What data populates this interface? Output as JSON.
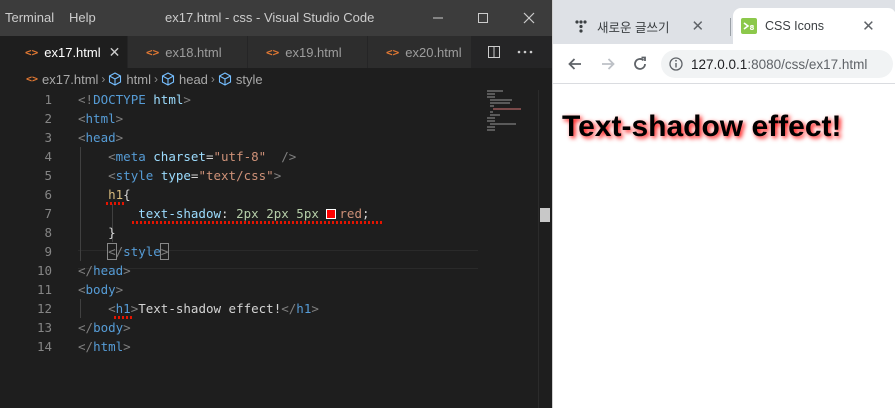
{
  "vscode": {
    "menu": [
      "Terminal",
      "Help"
    ],
    "window_title": "ex17.html - css - Visual Studio Code",
    "tabs": [
      {
        "label": "ex17.html",
        "active": true
      },
      {
        "label": "ex18.html",
        "active": false
      },
      {
        "label": "ex19.html",
        "active": false
      },
      {
        "label": "ex20.html",
        "active": false
      }
    ],
    "breadcrumb": [
      "ex17.html",
      "html",
      "head",
      "style"
    ],
    "line_numbers": [
      "1",
      "2",
      "3",
      "4",
      "5",
      "6",
      "7",
      "8",
      "9",
      "10",
      "11",
      "12",
      "13",
      "14"
    ],
    "code": {
      "l1": {
        "open": "<!",
        "tag": "DOCTYPE",
        "rest": " html",
        "close": ">"
      },
      "l2": {
        "tag": "html"
      },
      "l3": {
        "tag": "head"
      },
      "l4": {
        "tag": "meta",
        "attr": "charset",
        "eq": "=",
        "val": "\"utf-8\"",
        "close": "  />"
      },
      "l5": {
        "tag": "style",
        "attr": "type",
        "eq": "=",
        "val": "\"text/css\""
      },
      "l6": {
        "selector": "h1",
        "brace": "{"
      },
      "l7": {
        "prop": "text-shadow",
        "colon": ": ",
        "n1": "2px",
        "n2": "2px",
        "n3": "5px",
        "color": "red",
        "semi": ";"
      },
      "l8": {
        "brace": "}"
      },
      "l9": {
        "tag": "style"
      },
      "l10": {
        "tag": "head"
      },
      "l11": {
        "tag": "body"
      },
      "l12": {
        "tag": "h1",
        "text": "Text-shadow effect!",
        "close_tag": "h1"
      },
      "l13": {
        "tag": "body"
      },
      "l14": {
        "tag": "html"
      }
    },
    "colors": {
      "background": "#1e1e1e",
      "titlebar": "#3c3c3c",
      "tag": "#569cd6",
      "attribute": "#9cdcfe",
      "string": "#ce9178",
      "selector": "#d7ba7d",
      "error_squiggle": "#e51400"
    }
  },
  "browser": {
    "tabs": [
      {
        "label": "새로운 글쓰기",
        "icon": "dots-icon"
      },
      {
        "label": "CSS Icons",
        "icon": "css-icon"
      }
    ],
    "url_host": "127.0.0.1",
    "url_path": ":8080/css/ex17.html",
    "page_heading": "Text-shadow effect!",
    "colors": {
      "shadow": "#ff0000",
      "heading": "#000000"
    }
  }
}
